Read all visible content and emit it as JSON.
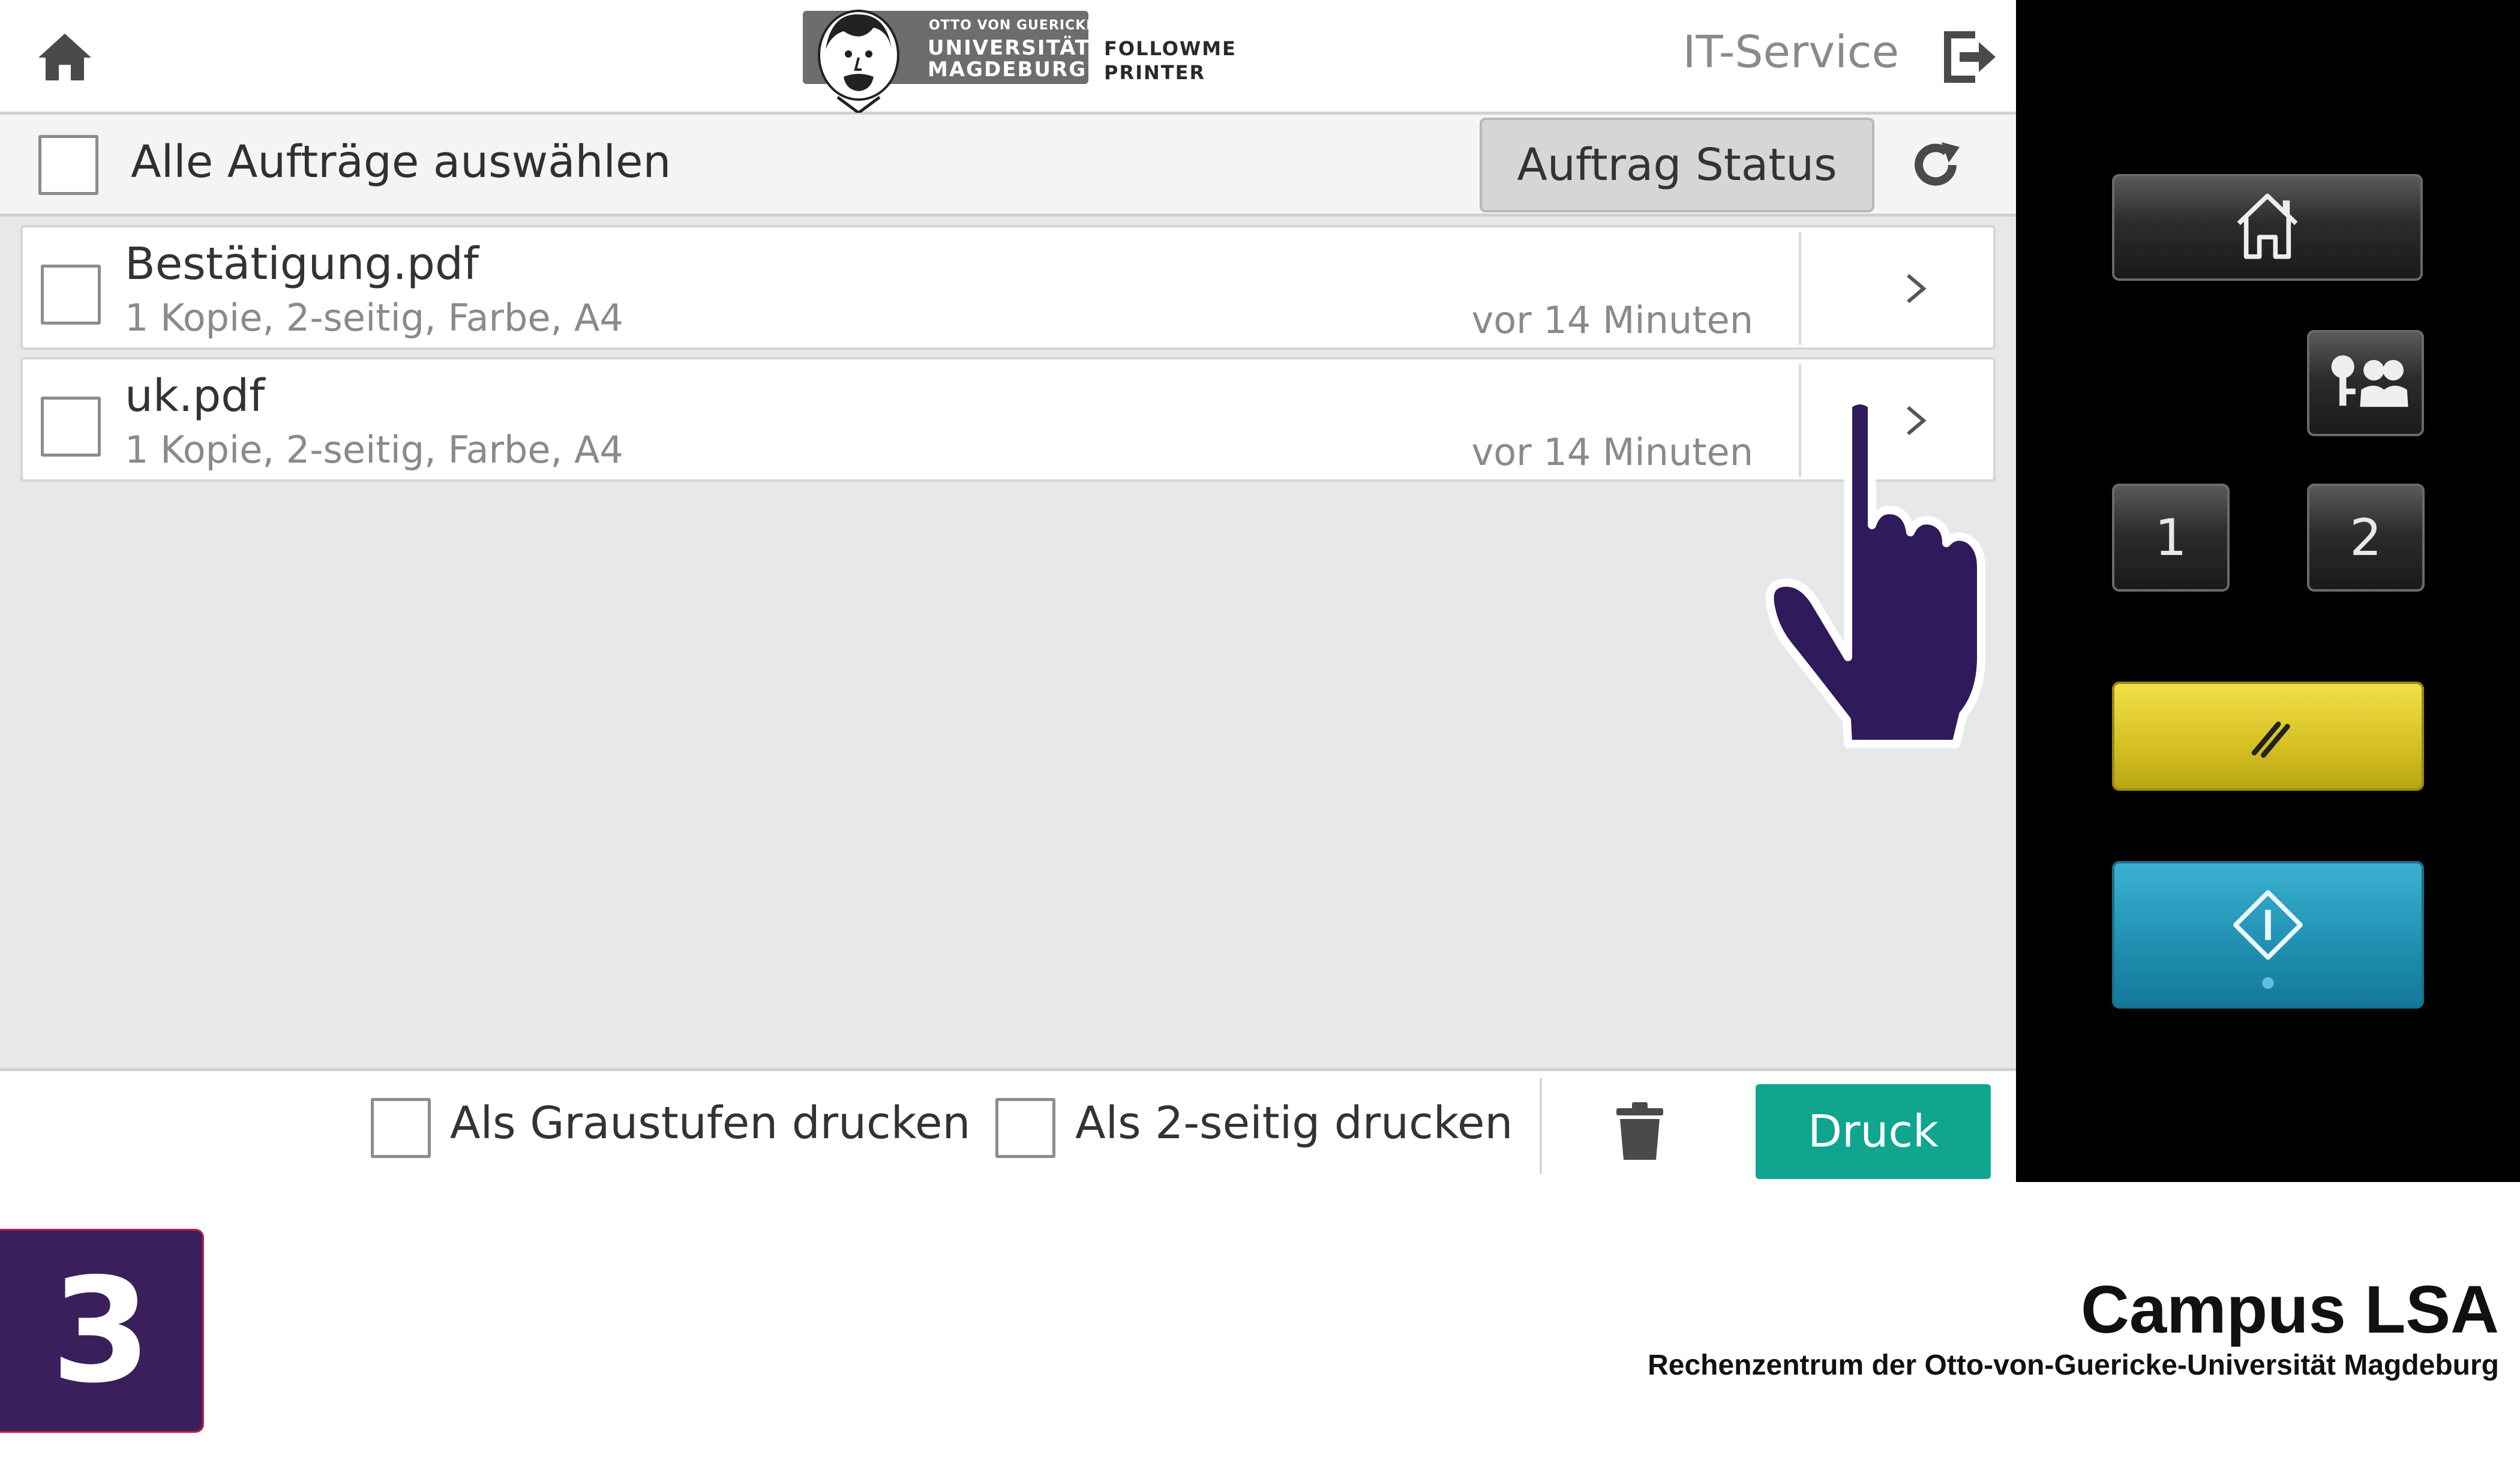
{
  "header": {
    "logo": {
      "top_line": "OTTO VON GUERICKE",
      "line1": "UNIVERSITÄT",
      "line2": "MAGDEBURG",
      "side1": "FOLLOWME",
      "side2": "PRINTER"
    },
    "user": "IT-Service"
  },
  "toolbar": {
    "select_all_label": "Alle Aufträge auswählen",
    "status_button": "Auftrag Status"
  },
  "jobs": [
    {
      "name": "Bestätigung.pdf",
      "details": "1 Kopie, 2-seitig, Farbe, A4",
      "time": "vor 14 Minuten"
    },
    {
      "name": "uk.pdf",
      "details": "1 Kopie, 2-seitig, Farbe, A4",
      "time": "vor 14 Minuten"
    }
  ],
  "bottom": {
    "grayscale_label": "Als Graustufen drucken",
    "duplex_label": "Als 2-seitig drucken",
    "print_button": "Druck"
  },
  "panel": {
    "button_1": "1",
    "button_2": "2"
  },
  "footer": {
    "step": "3",
    "brand_title": "Campus LSA",
    "brand_subtitle": "Rechenzentrum der Otto-von-Guericke-Universität Magdeburg"
  },
  "colors": {
    "print_button": "#0fa58f",
    "hand": "#2f1a5c",
    "step_badge": "#3a1f5c",
    "reset_key": "#d4c021",
    "start_key": "#1f8fb0"
  }
}
